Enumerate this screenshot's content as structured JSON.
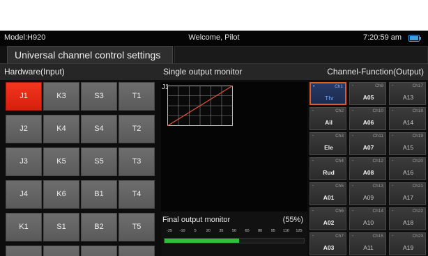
{
  "status_bar": {
    "model": "Model:H920",
    "welcome": "Welcome, Pilot",
    "time": "7:20:59 am",
    "battery_icon": "battery-icon"
  },
  "title_tab": "Universal channel control settings",
  "sections": {
    "hardware": "Hardware(Input)",
    "single_output": "Single output monitor",
    "channel_function": "Channel-Function(Output)"
  },
  "hardware_keys": {
    "row1": [
      "J1",
      "K3",
      "S3",
      "T1"
    ],
    "row2": [
      "J2",
      "K4",
      "S4",
      "T2"
    ],
    "row3": [
      "J3",
      "K5",
      "S5",
      "T3"
    ],
    "row4": [
      "J4",
      "K6",
      "B1",
      "T4"
    ],
    "row5": [
      "K1",
      "S1",
      "B2",
      "T5"
    ],
    "selected": "J1"
  },
  "monitor": {
    "channel_label": "J1",
    "curve": {
      "from": [
        -100,
        -100
      ],
      "to": [
        100,
        100
      ]
    }
  },
  "final_output": {
    "label": "Final output monitor",
    "percent": "(55%)",
    "value": 55,
    "scale": [
      "-25",
      "-10",
      "5",
      "20",
      "35",
      "50",
      "65",
      "80",
      "95",
      "110",
      "125"
    ]
  },
  "channel_functions": {
    "col1": [
      {
        "ch": "Ch1",
        "fn": "Thr"
      },
      {
        "ch": "Ch2",
        "fn": "Ail"
      },
      {
        "ch": "Ch3",
        "fn": "Ele"
      },
      {
        "ch": "Ch4",
        "fn": "Rud"
      },
      {
        "ch": "Ch5",
        "fn": "A01"
      },
      {
        "ch": "Ch6",
        "fn": "A02"
      },
      {
        "ch": "Ch7",
        "fn": "A03"
      }
    ],
    "col2": [
      {
        "ch": "Ch9",
        "fn": "A05"
      },
      {
        "ch": "Ch10",
        "fn": "A06"
      },
      {
        "ch": "Ch11",
        "fn": "A07"
      },
      {
        "ch": "Ch12",
        "fn": "A08"
      },
      {
        "ch": "Ch13",
        "fn": "A09"
      },
      {
        "ch": "Ch14",
        "fn": "A10"
      },
      {
        "ch": "Ch15",
        "fn": "A11"
      }
    ],
    "col3": [
      {
        "ch": "Ch17",
        "fn": "A13"
      },
      {
        "ch": "Ch18",
        "fn": "A14"
      },
      {
        "ch": "Ch19",
        "fn": "A15"
      },
      {
        "ch": "Ch20",
        "fn": "A16"
      },
      {
        "ch": "Ch21",
        "fn": "A17"
      },
      {
        "ch": "Ch22",
        "fn": "A18"
      },
      {
        "ch": "Ch23",
        "fn": "A19"
      }
    ],
    "selected": "Ch1"
  },
  "colors": {
    "selected_key": "#e8290f",
    "selected_channel_border": "#e35a21",
    "selected_channel_text": "#6fa8ff",
    "curve": "#e0503a",
    "output_bar": "#2fbf3a"
  }
}
